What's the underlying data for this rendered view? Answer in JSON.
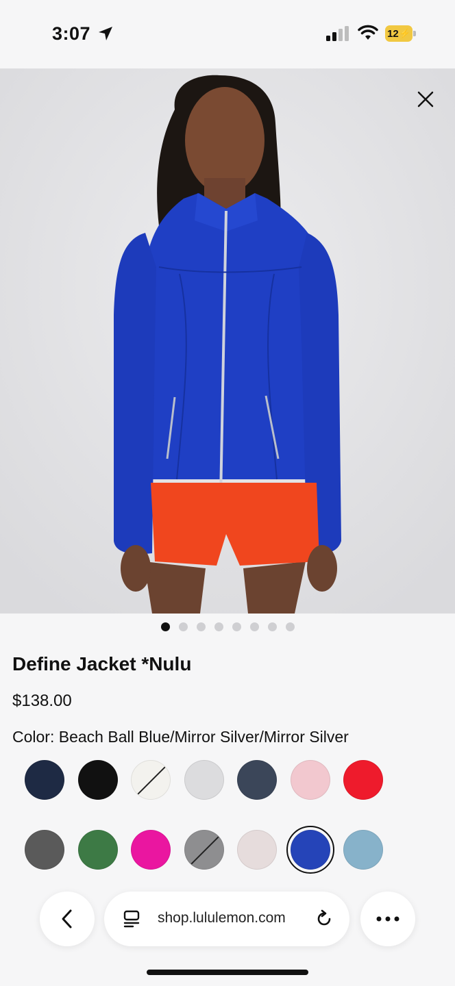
{
  "status_bar": {
    "time": "3:07",
    "battery": "12"
  },
  "product": {
    "title": "Define Jacket *Nulu",
    "price": "$138.00",
    "color_label": "Color: Beach Ball Blue/Mirror Silver/Mirror Silver",
    "image_page": 1,
    "image_count": 8
  },
  "swatches_row1": [
    {
      "name": "navy-zip",
      "color": "#1e2a44",
      "slashed": false
    },
    {
      "name": "black",
      "color": "#111111",
      "slashed": false
    },
    {
      "name": "white-zip",
      "color": "#f3f2ee",
      "slashed": true
    },
    {
      "name": "light-grey",
      "color": "#dcdcde",
      "slashed": false
    },
    {
      "name": "heathered-navy",
      "color": "#3b4659",
      "slashed": false
    },
    {
      "name": "pink",
      "color": "#f2c8cf",
      "slashed": false
    },
    {
      "name": "red",
      "color": "#ee1b2c",
      "slashed": false
    }
  ],
  "swatches_row2": [
    {
      "name": "leopard",
      "color": "#5a5a5a",
      "slashed": false
    },
    {
      "name": "green",
      "color": "#3d7a45",
      "slashed": false
    },
    {
      "name": "magenta",
      "color": "#ea16a0",
      "slashed": false
    },
    {
      "name": "grey-zip",
      "color": "#8e8e90",
      "slashed": true
    },
    {
      "name": "pink-gold",
      "color": "#e6dcdc",
      "slashed": false
    },
    {
      "name": "beach-ball-blue",
      "color": "#2544b8",
      "slashed": false,
      "selected": true
    },
    {
      "name": "light-blue",
      "color": "#87b2ca",
      "slashed": false
    }
  ],
  "browser": {
    "url": "shop.lululemon.com"
  }
}
